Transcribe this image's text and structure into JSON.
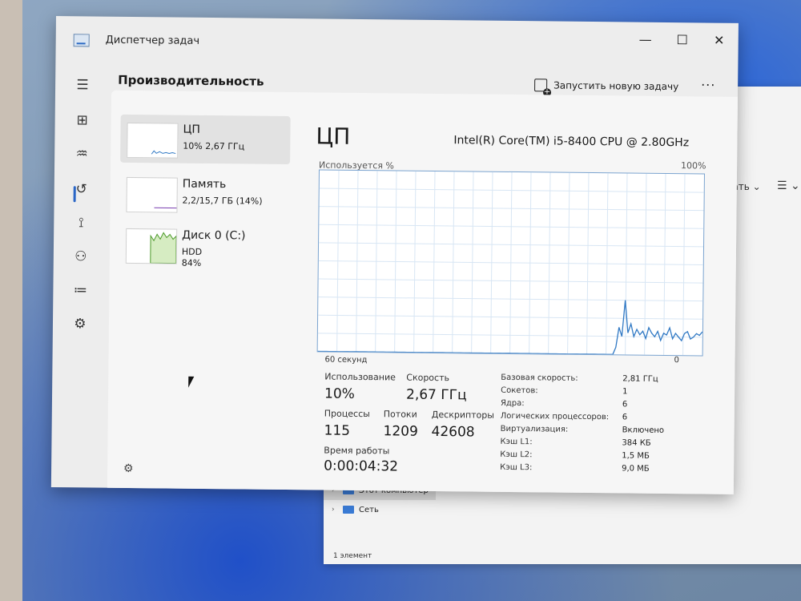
{
  "window": {
    "title": "Диспетчер задач",
    "min": "—",
    "max": "☐",
    "close": "✕"
  },
  "header": {
    "title": "Производительность",
    "run_task": "Запустить новую задачу",
    "more": "···"
  },
  "nav": [
    {
      "icon": "hamburger-icon",
      "glyph": "☰"
    },
    {
      "icon": "processes-icon",
      "glyph": "⊞"
    },
    {
      "icon": "performance-icon",
      "glyph": "♒"
    },
    {
      "icon": "app-history-icon",
      "glyph": "↺"
    },
    {
      "icon": "startup-apps-icon",
      "glyph": "⟟"
    },
    {
      "icon": "users-icon",
      "glyph": "⚇"
    },
    {
      "icon": "details-icon",
      "glyph": "≔"
    },
    {
      "icon": "services-icon",
      "glyph": "⚙"
    }
  ],
  "settings_glyph": "⚙",
  "perf_list": [
    {
      "name": "ЦП",
      "sub": "10% 2,67 ГГц",
      "sub2": ""
    },
    {
      "name": "Память",
      "sub": "2,2/15,7 ГБ (14%)",
      "sub2": ""
    },
    {
      "name": "Диск 0 (C:)",
      "sub": "HDD",
      "sub2": "84%"
    }
  ],
  "detail": {
    "title": "ЦП",
    "model": "Intel(R) Core(TM) i5-8400 CPU @ 2.80GHz",
    "usage_label": "Используется %",
    "max_label": "100%",
    "time_label": "60 секунд",
    "zero_label": "0",
    "stats": {
      "usage_label": "Использование",
      "usage_value": "10%",
      "speed_label": "Скорость",
      "speed_value": "2,67 ГГц",
      "processes_label": "Процессы",
      "processes_value": "115",
      "threads_label": "Потоки",
      "threads_value": "1209",
      "handles_label": "Дескрипторы",
      "handles_value": "42608",
      "uptime_label": "Время работы",
      "uptime_value": "0:00:04:32"
    },
    "specs": [
      {
        "k": "Базовая скорость:",
        "v": "2,81 ГГц"
      },
      {
        "k": "Сокетов:",
        "v": "1"
      },
      {
        "k": "Ядра:",
        "v": "6"
      },
      {
        "k": "Логических процессоров:",
        "v": "6"
      },
      {
        "k": "Виртуализация:",
        "v": "Включено"
      },
      {
        "k": "Кэш L1:",
        "v": "384 КБ"
      },
      {
        "k": "Кэш L2:",
        "v": "1,5 МБ"
      },
      {
        "k": "Кэш L3:",
        "v": "9,0 МБ"
      }
    ]
  },
  "cpu_graph": {
    "unit": "%",
    "ylim": [
      0,
      100
    ],
    "values": [
      0,
      0,
      0,
      0,
      0,
      0,
      0,
      0,
      0,
      0,
      0,
      0,
      0,
      0,
      0,
      0,
      0,
      0,
      0,
      0,
      0,
      0,
      0,
      0,
      0,
      0,
      0,
      0,
      0,
      0,
      0,
      0,
      0,
      0,
      0,
      0,
      0,
      0,
      0,
      0,
      0,
      0,
      0,
      0,
      0,
      0,
      0,
      0,
      0,
      0,
      0,
      0,
      0,
      0,
      0,
      0,
      0,
      0,
      0,
      0,
      0,
      0,
      0,
      0,
      0,
      0,
      0,
      0,
      0,
      0,
      0,
      0,
      0,
      0,
      0,
      0,
      0,
      0,
      0,
      0,
      0,
      0,
      0,
      0,
      0,
      0,
      0,
      0,
      0,
      0,
      0,
      0,
      0,
      0,
      0,
      0,
      0,
      0,
      0,
      0,
      4,
      15,
      10,
      30,
      12,
      17,
      10,
      14,
      11,
      13,
      9,
      15,
      12,
      10,
      13,
      8,
      12,
      11,
      15,
      9,
      12,
      10,
      8,
      12,
      13,
      9,
      10,
      12,
      11,
      13
    ],
    "color": "#2f78c4"
  },
  "explorer": {
    "toolbar_fragment": "овать ⌄",
    "view_icon": "☰ ⌄",
    "tree": [
      {
        "label": "Этот компьютер"
      },
      {
        "label": "Сеть"
      }
    ],
    "status": "1 элемент"
  }
}
